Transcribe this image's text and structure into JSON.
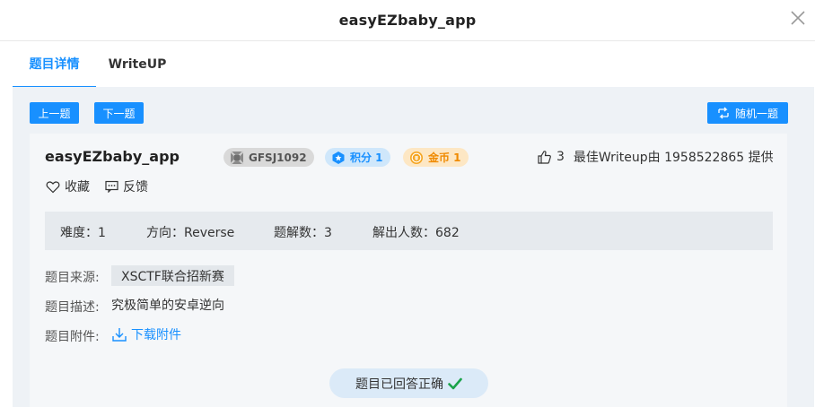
{
  "window": {
    "title": "easyEZbaby_app"
  },
  "tabs": [
    {
      "label": "题目详情",
      "active": true
    },
    {
      "label": "WriteUP",
      "active": false
    }
  ],
  "toolbar": {
    "prev_label": "上一题",
    "next_label": "下一题",
    "random_label": "随机一题"
  },
  "challenge": {
    "name": "easyEZbaby_app",
    "id_badge": "GFSJ1092",
    "points_badge": "积分 1",
    "coins_badge": "金币 1",
    "likes": "3",
    "best_writeup": "最佳Writeup由 1958522865 提供",
    "favorite_label": "收藏",
    "feedback_label": "反馈"
  },
  "stats": {
    "difficulty": "难度：1",
    "direction": "方向：Reverse",
    "solves": "题解数：3",
    "solvers": "解出人数：682"
  },
  "details": {
    "source_label": "题目来源:",
    "source_value": "XSCTF联合招新赛",
    "desc_label": "题目描述:",
    "desc_value": "究极简单的安卓逆向",
    "attachment_label": "题目附件:",
    "attachment_link": "下载附件"
  },
  "status": {
    "answered_text": "题目已回答正确"
  },
  "colors": {
    "accent": "#1890ff",
    "success": "#1aa34a",
    "coin": "#f0a020"
  }
}
